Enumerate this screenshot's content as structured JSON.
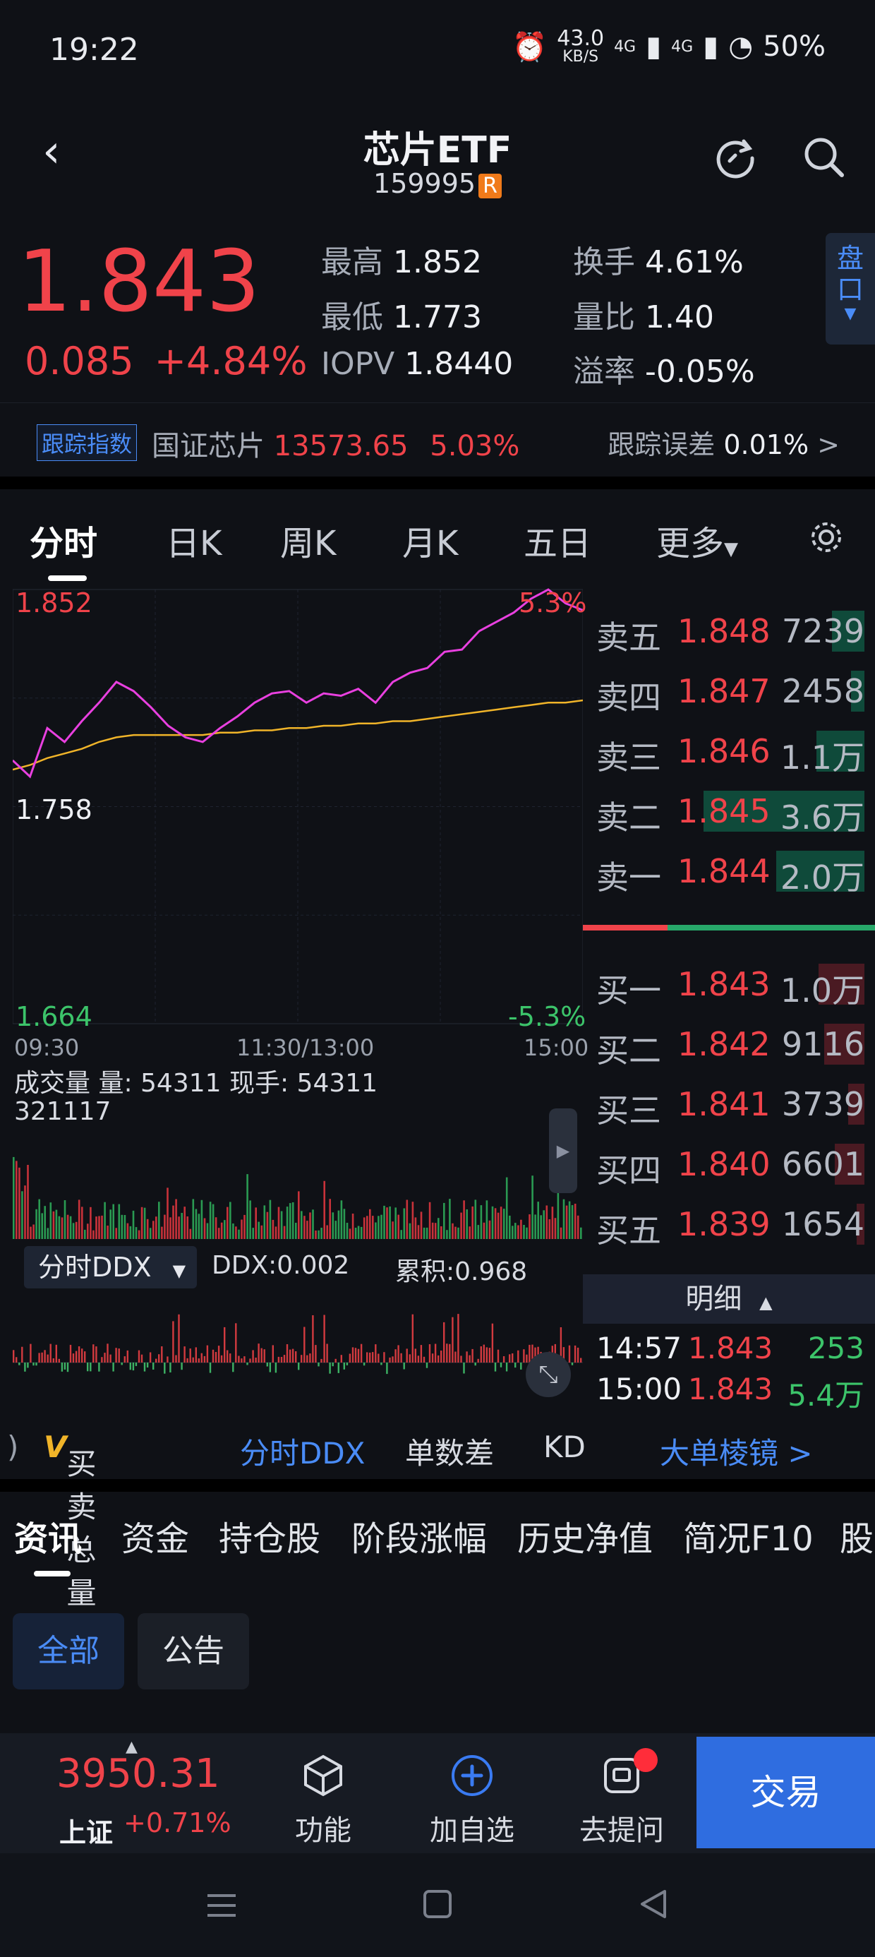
{
  "status_bar": {
    "time": "19:22",
    "net_speed": "43.0",
    "net_unit": "KB/S",
    "sig1": "4G",
    "sig2": "4G",
    "battery": "50%"
  },
  "header": {
    "title": "芯片ETF",
    "code": "159995",
    "badge": "R"
  },
  "quote": {
    "price": "1.843",
    "change": "0.085",
    "change_pct": "+4.84%",
    "high_label": "最高",
    "high": "1.852",
    "low_label": "最低",
    "low": "1.773",
    "iopv_label": "IOPV",
    "iopv": "1.8440",
    "turnover_label": "换手",
    "turnover": "4.61%",
    "vol_ratio_label": "量比",
    "vol_ratio": "1.40",
    "premium_label": "溢率",
    "premium": "-0.05%",
    "side_tab": "盘口"
  },
  "tracking": {
    "tag": "跟踪指数",
    "index_name": "国证芯片",
    "index_value": "13573.65",
    "index_pct": "5.03%",
    "error_label": "跟踪误差",
    "error_value": "0.01%",
    "arrow": ">"
  },
  "chart_tabs": [
    "分时",
    "日K",
    "周K",
    "月K",
    "五日",
    "更多"
  ],
  "chart_data": {
    "type": "line",
    "ylim": [
      1.664,
      1.852
    ],
    "y_labels": {
      "top": "1.852",
      "mid": "1.758",
      "bottom": "1.664"
    },
    "pct_labels": {
      "top": "5.3%",
      "bottom": "-5.3%"
    },
    "x_labels": [
      "09:30",
      "11:30/13:00",
      "15:00"
    ],
    "series": [
      {
        "values": [
          1.778,
          1.771,
          1.792,
          1.786,
          1.795,
          1.803,
          1.812,
          1.808,
          1.801,
          1.793,
          1.788,
          1.786,
          1.792,
          1.797,
          1.803,
          1.807,
          1.808,
          1.803,
          1.807,
          1.806,
          1.809,
          1.803,
          1.812,
          1.816,
          1.818,
          1.825,
          1.826,
          1.834,
          1.838,
          1.842,
          1.848,
          1.852,
          1.846,
          1.843
        ]
      },
      {
        "values": [
          1.774,
          1.776,
          1.779,
          1.781,
          1.783,
          1.786,
          1.788,
          1.789,
          1.789,
          1.789,
          1.789,
          1.789,
          1.79,
          1.79,
          1.791,
          1.791,
          1.792,
          1.792,
          1.793,
          1.793,
          1.794,
          1.794,
          1.795,
          1.795,
          1.796,
          1.797,
          1.798,
          1.799,
          1.8,
          1.801,
          1.802,
          1.803,
          1.803,
          1.804
        ]
      }
    ],
    "colors": {
      "price": "#e940e0",
      "avg": "#f0b429"
    }
  },
  "volume": {
    "title": "成交量 量: 54311 现手: 54311",
    "max": "321117"
  },
  "ddx": {
    "dropdown": "分时DDX",
    "value": "DDX:0.002",
    "cumulative": "累积:0.968"
  },
  "order_book": {
    "asks": [
      {
        "label": "卖五",
        "price": "1.848",
        "vol": "7239",
        "bar": 0.12
      },
      {
        "label": "卖四",
        "price": "1.847",
        "vol": "2458",
        "bar": 0.05
      },
      {
        "label": "卖三",
        "price": "1.846",
        "vol": "1.1万",
        "bar": 0.18
      },
      {
        "label": "卖二",
        "price": "1.845",
        "vol": "3.6万",
        "bar": 0.6
      },
      {
        "label": "卖一",
        "price": "1.844",
        "vol": "2.0万",
        "bar": 0.33
      }
    ],
    "bids": [
      {
        "label": "买一",
        "price": "1.843",
        "vol": "1.0万",
        "bar": 0.17
      },
      {
        "label": "买二",
        "price": "1.842",
        "vol": "9116",
        "bar": 0.15
      },
      {
        "label": "买三",
        "price": "1.841",
        "vol": "3739",
        "bar": 0.06
      },
      {
        "label": "买四",
        "price": "1.840",
        "vol": "6601",
        "bar": 0.11
      },
      {
        "label": "买五",
        "price": "1.839",
        "vol": "1654",
        "bar": 0.03
      }
    ],
    "detail_label": "明细",
    "ticks": [
      {
        "time": "14:57",
        "price": "1.843",
        "vol": "253"
      },
      {
        "time": "15:00",
        "price": "1.843",
        "vol": "5.4万"
      }
    ]
  },
  "indicator_tabs": {
    "left_edge": ")",
    "v_mark": "V",
    "t1": "买卖总量",
    "t2": "分时DDX",
    "t3": "单数差",
    "t4": "KD",
    "right": "大单棱镜 >"
  },
  "info_tabs": [
    "资讯",
    "资金",
    "持仓股",
    "阶段涨幅",
    "历史净值",
    "简况F10",
    "股"
  ],
  "filter_chips": [
    "全部",
    "公告"
  ],
  "bottom_bar": {
    "index_value": "3950.31",
    "index_name": "上证",
    "index_change": "+0.71%",
    "nav": [
      "功能",
      "加自选",
      "去提问"
    ],
    "trade": "交易"
  }
}
